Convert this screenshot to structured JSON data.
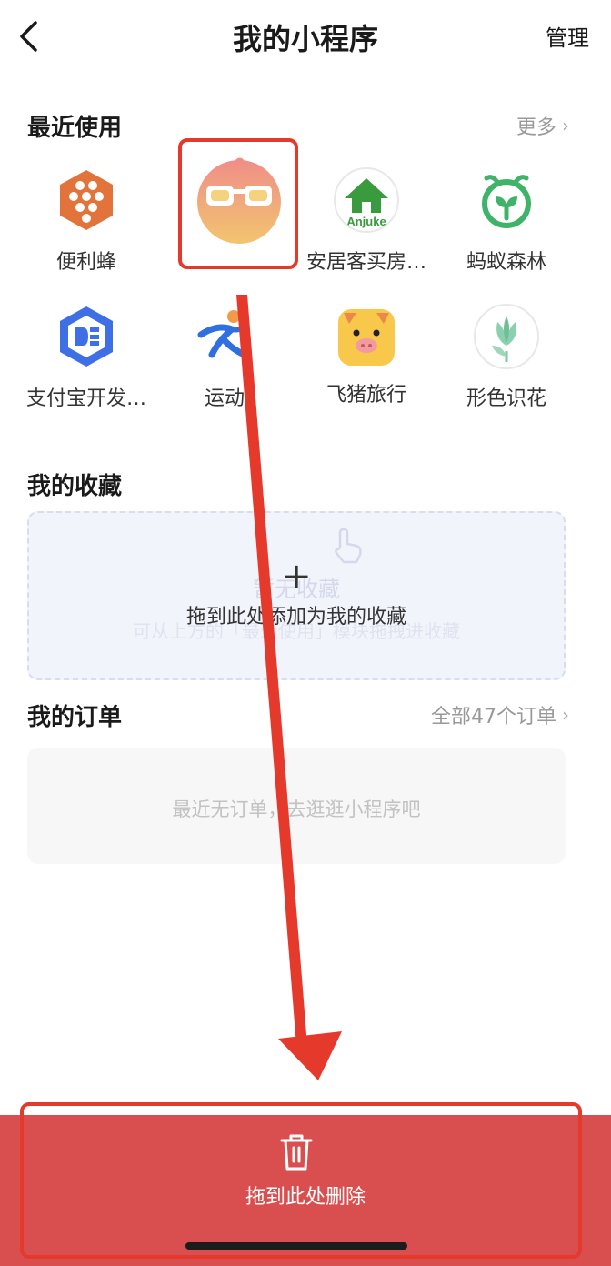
{
  "header": {
    "title": "我的小程序",
    "manage_label": "管理"
  },
  "recent": {
    "title": "最近使用",
    "more_label": "更多",
    "apps": [
      {
        "label": "便利蜂",
        "icon": "honeycomb-icon"
      },
      {
        "label": "",
        "icon": "sunglasses-avatar-icon"
      },
      {
        "label": "安居客买房…",
        "icon": "anjuke-house-icon",
        "icon_text": "Anjuke"
      },
      {
        "label": "蚂蚁森林",
        "icon": "sprout-icon"
      },
      {
        "label": "支付宝开发…",
        "icon": "alipay-dev-icon"
      },
      {
        "label": "运动",
        "icon": "running-icon"
      },
      {
        "label": "飞猪旅行",
        "icon": "pig-icon"
      },
      {
        "label": "形色识花",
        "icon": "flower-icon"
      }
    ]
  },
  "favorites": {
    "title": "我的收藏",
    "ghost_title": "暂无收藏",
    "ghost_subtitle": "可从上方的「最近使用」模块拖拽进收藏",
    "plus": "+",
    "drop_hint": "拖到此处添加为我的收藏"
  },
  "orders": {
    "title": "我的订单",
    "all_label": "全部47个订单",
    "empty_text": "最近无订单，去逛逛小程序吧"
  },
  "delete_zone": {
    "label": "拖到此处删除"
  },
  "colors": {
    "delete_bg": "#d94f4f",
    "annotation": "#e53a2b",
    "fav_bg": "#f2f4fc"
  }
}
